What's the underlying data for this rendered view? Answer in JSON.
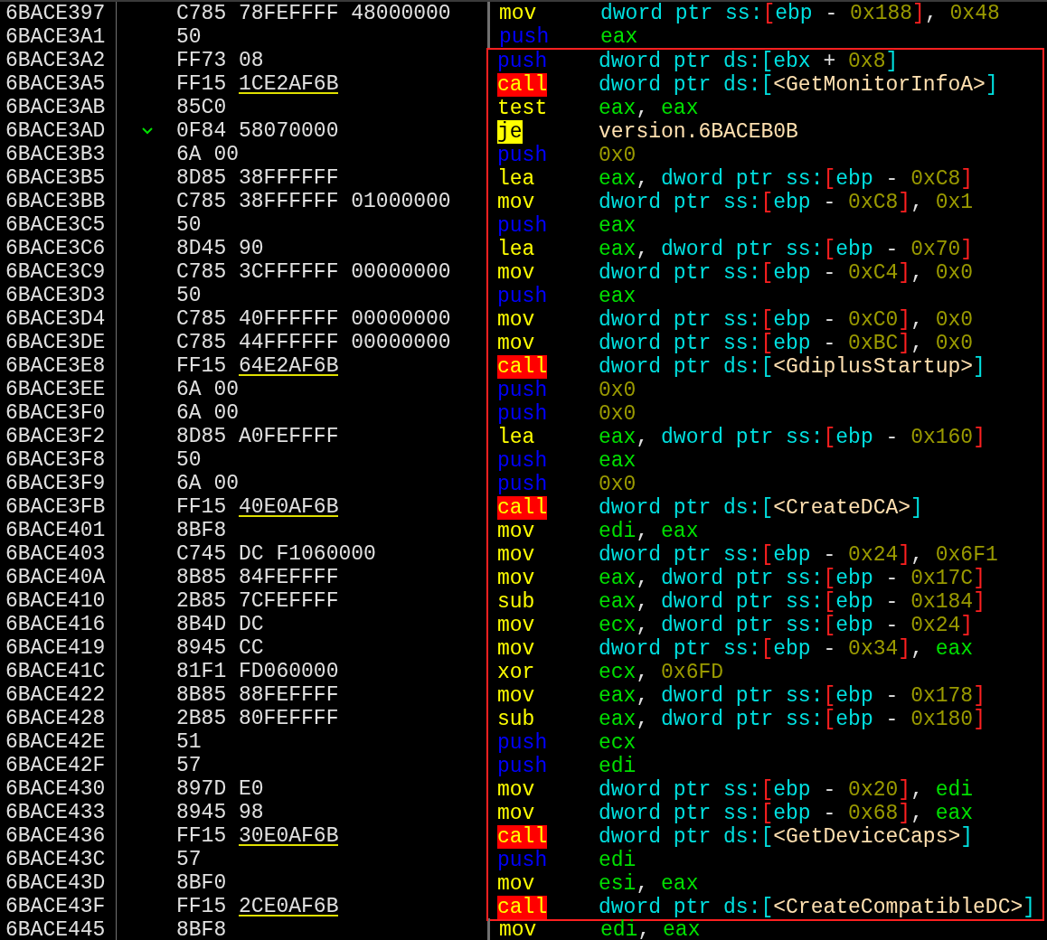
{
  "rows": [
    {
      "address": "6BACE397",
      "branch": false,
      "bytes": "C785 78FEFFFF 48000000",
      "mnemonic": "mov",
      "kind": "plain",
      "boxed": false,
      "operands": [
        {
          "kind": "mem",
          "text": "dword ptr ss:"
        },
        {
          "kind": "bracket",
          "text": "["
        },
        {
          "kind": "mem",
          "text": "ebp"
        },
        {
          "kind": "sep",
          "text": " - "
        },
        {
          "kind": "num",
          "text": "0x188"
        },
        {
          "kind": "bracket",
          "text": "]"
        },
        {
          "kind": "sep",
          "text": ", "
        },
        {
          "kind": "num",
          "text": "0x48"
        }
      ]
    },
    {
      "address": "6BACE3A1",
      "branch": false,
      "bytes": "50",
      "mnemonic": "push",
      "kind": "push",
      "boxed": false,
      "operands": [
        {
          "kind": "reg",
          "text": "eax"
        }
      ]
    },
    {
      "address": "6BACE3A2",
      "branch": false,
      "bytes": "FF73 08",
      "mnemonic": "push",
      "kind": "push",
      "boxed": true,
      "operands": [
        {
          "kind": "mem",
          "text": "dword ptr ds:[ebx"
        },
        {
          "kind": "sep",
          "text": " + "
        },
        {
          "kind": "num",
          "text": "0x8"
        },
        {
          "kind": "mem",
          "text": "]"
        }
      ]
    },
    {
      "address": "6BACE3A5",
      "branch": false,
      "bytes": "FF15",
      "ref": "1CE2AF6B",
      "mnemonic": "call",
      "kind": "call",
      "boxed": true,
      "operands": [
        {
          "kind": "mem",
          "text": "dword ptr ds:["
        },
        {
          "kind": "sym",
          "text": "<GetMonitorInfoA>"
        },
        {
          "kind": "mem",
          "text": "]"
        }
      ]
    },
    {
      "address": "6BACE3AB",
      "branch": false,
      "bytes": "85C0",
      "mnemonic": "test",
      "kind": "plain",
      "boxed": true,
      "operands": [
        {
          "kind": "reg",
          "text": "eax"
        },
        {
          "kind": "sep",
          "text": ", "
        },
        {
          "kind": "reg",
          "text": "eax"
        }
      ]
    },
    {
      "address": "6BACE3AD",
      "branch": true,
      "bytes": "0F84 58070000",
      "mnemonic": "je",
      "kind": "jump",
      "boxed": true,
      "operands": [
        {
          "kind": "sym",
          "text": "version.6BACEB0B"
        }
      ]
    },
    {
      "address": "6BACE3B3",
      "branch": false,
      "bytes": "6A 00",
      "mnemonic": "push",
      "kind": "push",
      "boxed": true,
      "operands": [
        {
          "kind": "num",
          "text": "0x0"
        }
      ]
    },
    {
      "address": "6BACE3B5",
      "branch": false,
      "bytes": "8D85 38FFFFFF",
      "mnemonic": "lea",
      "kind": "plain",
      "boxed": true,
      "operands": [
        {
          "kind": "reg",
          "text": "eax"
        },
        {
          "kind": "sep",
          "text": ", "
        },
        {
          "kind": "mem",
          "text": "dword ptr ss:"
        },
        {
          "kind": "bracket",
          "text": "["
        },
        {
          "kind": "mem",
          "text": "ebp"
        },
        {
          "kind": "sep",
          "text": " - "
        },
        {
          "kind": "num",
          "text": "0xC8"
        },
        {
          "kind": "bracket",
          "text": "]"
        }
      ]
    },
    {
      "address": "6BACE3BB",
      "branch": false,
      "bytes": "C785 38FFFFFF 01000000",
      "mnemonic": "mov",
      "kind": "plain",
      "boxed": true,
      "operands": [
        {
          "kind": "mem",
          "text": "dword ptr ss:"
        },
        {
          "kind": "bracket",
          "text": "["
        },
        {
          "kind": "mem",
          "text": "ebp"
        },
        {
          "kind": "sep",
          "text": " - "
        },
        {
          "kind": "num",
          "text": "0xC8"
        },
        {
          "kind": "bracket",
          "text": "]"
        },
        {
          "kind": "sep",
          "text": ", "
        },
        {
          "kind": "num",
          "text": "0x1"
        }
      ]
    },
    {
      "address": "6BACE3C5",
      "branch": false,
      "bytes": "50",
      "mnemonic": "push",
      "kind": "push",
      "boxed": true,
      "operands": [
        {
          "kind": "reg",
          "text": "eax"
        }
      ]
    },
    {
      "address": "6BACE3C6",
      "branch": false,
      "bytes": "8D45 90",
      "mnemonic": "lea",
      "kind": "plain",
      "boxed": true,
      "operands": [
        {
          "kind": "reg",
          "text": "eax"
        },
        {
          "kind": "sep",
          "text": ", "
        },
        {
          "kind": "mem",
          "text": "dword ptr ss:"
        },
        {
          "kind": "bracket",
          "text": "["
        },
        {
          "kind": "mem",
          "text": "ebp"
        },
        {
          "kind": "sep",
          "text": " - "
        },
        {
          "kind": "num",
          "text": "0x70"
        },
        {
          "kind": "bracket",
          "text": "]"
        }
      ]
    },
    {
      "address": "6BACE3C9",
      "branch": false,
      "bytes": "C785 3CFFFFFF 00000000",
      "mnemonic": "mov",
      "kind": "plain",
      "boxed": true,
      "operands": [
        {
          "kind": "mem",
          "text": "dword ptr ss:"
        },
        {
          "kind": "bracket",
          "text": "["
        },
        {
          "kind": "mem",
          "text": "ebp"
        },
        {
          "kind": "sep",
          "text": " - "
        },
        {
          "kind": "num",
          "text": "0xC4"
        },
        {
          "kind": "bracket",
          "text": "]"
        },
        {
          "kind": "sep",
          "text": ", "
        },
        {
          "kind": "num",
          "text": "0x0"
        }
      ]
    },
    {
      "address": "6BACE3D3",
      "branch": false,
      "bytes": "50",
      "mnemonic": "push",
      "kind": "push",
      "boxed": true,
      "operands": [
        {
          "kind": "reg",
          "text": "eax"
        }
      ]
    },
    {
      "address": "6BACE3D4",
      "branch": false,
      "bytes": "C785 40FFFFFF 00000000",
      "mnemonic": "mov",
      "kind": "plain",
      "boxed": true,
      "operands": [
        {
          "kind": "mem",
          "text": "dword ptr ss:"
        },
        {
          "kind": "bracket",
          "text": "["
        },
        {
          "kind": "mem",
          "text": "ebp"
        },
        {
          "kind": "sep",
          "text": " - "
        },
        {
          "kind": "num",
          "text": "0xC0"
        },
        {
          "kind": "bracket",
          "text": "]"
        },
        {
          "kind": "sep",
          "text": ", "
        },
        {
          "kind": "num",
          "text": "0x0"
        }
      ]
    },
    {
      "address": "6BACE3DE",
      "branch": false,
      "bytes": "C785 44FFFFFF 00000000",
      "mnemonic": "mov",
      "kind": "plain",
      "boxed": true,
      "operands": [
        {
          "kind": "mem",
          "text": "dword ptr ss:"
        },
        {
          "kind": "bracket",
          "text": "["
        },
        {
          "kind": "mem",
          "text": "ebp"
        },
        {
          "kind": "sep",
          "text": " - "
        },
        {
          "kind": "num",
          "text": "0xBC"
        },
        {
          "kind": "bracket",
          "text": "]"
        },
        {
          "kind": "sep",
          "text": ", "
        },
        {
          "kind": "num",
          "text": "0x0"
        }
      ]
    },
    {
      "address": "6BACE3E8",
      "branch": false,
      "bytes": "FF15",
      "ref": "64E2AF6B",
      "mnemonic": "call",
      "kind": "call",
      "boxed": true,
      "operands": [
        {
          "kind": "mem",
          "text": "dword ptr ds:["
        },
        {
          "kind": "sym",
          "text": "<GdiplusStartup>"
        },
        {
          "kind": "mem",
          "text": "]"
        }
      ]
    },
    {
      "address": "6BACE3EE",
      "branch": false,
      "bytes": "6A 00",
      "mnemonic": "push",
      "kind": "push",
      "boxed": true,
      "operands": [
        {
          "kind": "num",
          "text": "0x0"
        }
      ]
    },
    {
      "address": "6BACE3F0",
      "branch": false,
      "bytes": "6A 00",
      "mnemonic": "push",
      "kind": "push",
      "boxed": true,
      "operands": [
        {
          "kind": "num",
          "text": "0x0"
        }
      ]
    },
    {
      "address": "6BACE3F2",
      "branch": false,
      "bytes": "8D85 A0FEFFFF",
      "mnemonic": "lea",
      "kind": "plain",
      "boxed": true,
      "operands": [
        {
          "kind": "reg",
          "text": "eax"
        },
        {
          "kind": "sep",
          "text": ", "
        },
        {
          "kind": "mem",
          "text": "dword ptr ss:"
        },
        {
          "kind": "bracket",
          "text": "["
        },
        {
          "kind": "mem",
          "text": "ebp"
        },
        {
          "kind": "sep",
          "text": " - "
        },
        {
          "kind": "num",
          "text": "0x160"
        },
        {
          "kind": "bracket",
          "text": "]"
        }
      ]
    },
    {
      "address": "6BACE3F8",
      "branch": false,
      "bytes": "50",
      "mnemonic": "push",
      "kind": "push",
      "boxed": true,
      "operands": [
        {
          "kind": "reg",
          "text": "eax"
        }
      ]
    },
    {
      "address": "6BACE3F9",
      "branch": false,
      "bytes": "6A 00",
      "mnemonic": "push",
      "kind": "push",
      "boxed": true,
      "operands": [
        {
          "kind": "num",
          "text": "0x0"
        }
      ]
    },
    {
      "address": "6BACE3FB",
      "branch": false,
      "bytes": "FF15",
      "ref": "40E0AF6B",
      "mnemonic": "call",
      "kind": "call",
      "boxed": true,
      "operands": [
        {
          "kind": "mem",
          "text": "dword ptr ds:["
        },
        {
          "kind": "sym",
          "text": "<CreateDCA>"
        },
        {
          "kind": "mem",
          "text": "]"
        }
      ]
    },
    {
      "address": "6BACE401",
      "branch": false,
      "bytes": "8BF8",
      "mnemonic": "mov",
      "kind": "plain",
      "boxed": true,
      "operands": [
        {
          "kind": "reg",
          "text": "edi"
        },
        {
          "kind": "sep",
          "text": ", "
        },
        {
          "kind": "reg",
          "text": "eax"
        }
      ]
    },
    {
      "address": "6BACE403",
      "branch": false,
      "bytes": "C745 DC F1060000",
      "mnemonic": "mov",
      "kind": "plain",
      "boxed": true,
      "operands": [
        {
          "kind": "mem",
          "text": "dword ptr ss:"
        },
        {
          "kind": "bracket",
          "text": "["
        },
        {
          "kind": "mem",
          "text": "ebp"
        },
        {
          "kind": "sep",
          "text": " - "
        },
        {
          "kind": "num",
          "text": "0x24"
        },
        {
          "kind": "bracket",
          "text": "]"
        },
        {
          "kind": "sep",
          "text": ", "
        },
        {
          "kind": "num",
          "text": "0x6F1"
        }
      ]
    },
    {
      "address": "6BACE40A",
      "branch": false,
      "bytes": "8B85 84FEFFFF",
      "mnemonic": "mov",
      "kind": "plain",
      "boxed": true,
      "operands": [
        {
          "kind": "reg",
          "text": "eax"
        },
        {
          "kind": "sep",
          "text": ", "
        },
        {
          "kind": "mem",
          "text": "dword ptr ss:"
        },
        {
          "kind": "bracket",
          "text": "["
        },
        {
          "kind": "mem",
          "text": "ebp"
        },
        {
          "kind": "sep",
          "text": " - "
        },
        {
          "kind": "num",
          "text": "0x17C"
        },
        {
          "kind": "bracket",
          "text": "]"
        }
      ]
    },
    {
      "address": "6BACE410",
      "branch": false,
      "bytes": "2B85 7CFEFFFF",
      "mnemonic": "sub",
      "kind": "plain",
      "boxed": true,
      "operands": [
        {
          "kind": "reg",
          "text": "eax"
        },
        {
          "kind": "sep",
          "text": ", "
        },
        {
          "kind": "mem",
          "text": "dword ptr ss:"
        },
        {
          "kind": "bracket",
          "text": "["
        },
        {
          "kind": "mem",
          "text": "ebp"
        },
        {
          "kind": "sep",
          "text": " - "
        },
        {
          "kind": "num",
          "text": "0x184"
        },
        {
          "kind": "bracket",
          "text": "]"
        }
      ]
    },
    {
      "address": "6BACE416",
      "branch": false,
      "bytes": "8B4D DC",
      "mnemonic": "mov",
      "kind": "plain",
      "boxed": true,
      "operands": [
        {
          "kind": "reg",
          "text": "ecx"
        },
        {
          "kind": "sep",
          "text": ", "
        },
        {
          "kind": "mem",
          "text": "dword ptr ss:"
        },
        {
          "kind": "bracket",
          "text": "["
        },
        {
          "kind": "mem",
          "text": "ebp"
        },
        {
          "kind": "sep",
          "text": " - "
        },
        {
          "kind": "num",
          "text": "0x24"
        },
        {
          "kind": "bracket",
          "text": "]"
        }
      ]
    },
    {
      "address": "6BACE419",
      "branch": false,
      "bytes": "8945 CC",
      "mnemonic": "mov",
      "kind": "plain",
      "boxed": true,
      "operands": [
        {
          "kind": "mem",
          "text": "dword ptr ss:"
        },
        {
          "kind": "bracket",
          "text": "["
        },
        {
          "kind": "mem",
          "text": "ebp"
        },
        {
          "kind": "sep",
          "text": " - "
        },
        {
          "kind": "num",
          "text": "0x34"
        },
        {
          "kind": "bracket",
          "text": "]"
        },
        {
          "kind": "sep",
          "text": ", "
        },
        {
          "kind": "reg",
          "text": "eax"
        }
      ]
    },
    {
      "address": "6BACE41C",
      "branch": false,
      "bytes": "81F1 FD060000",
      "mnemonic": "xor",
      "kind": "plain",
      "boxed": true,
      "operands": [
        {
          "kind": "reg",
          "text": "ecx"
        },
        {
          "kind": "sep",
          "text": ", "
        },
        {
          "kind": "num",
          "text": "0x6FD"
        }
      ]
    },
    {
      "address": "6BACE422",
      "branch": false,
      "bytes": "8B85 88FEFFFF",
      "mnemonic": "mov",
      "kind": "plain",
      "boxed": true,
      "operands": [
        {
          "kind": "reg",
          "text": "eax"
        },
        {
          "kind": "sep",
          "text": ", "
        },
        {
          "kind": "mem",
          "text": "dword ptr ss:"
        },
        {
          "kind": "bracket",
          "text": "["
        },
        {
          "kind": "mem",
          "text": "ebp"
        },
        {
          "kind": "sep",
          "text": " - "
        },
        {
          "kind": "num",
          "text": "0x178"
        },
        {
          "kind": "bracket",
          "text": "]"
        }
      ]
    },
    {
      "address": "6BACE428",
      "branch": false,
      "bytes": "2B85 80FEFFFF",
      "mnemonic": "sub",
      "kind": "plain",
      "boxed": true,
      "operands": [
        {
          "kind": "reg",
          "text": "eax"
        },
        {
          "kind": "sep",
          "text": ", "
        },
        {
          "kind": "mem",
          "text": "dword ptr ss:"
        },
        {
          "kind": "bracket",
          "text": "["
        },
        {
          "kind": "mem",
          "text": "ebp"
        },
        {
          "kind": "sep",
          "text": " - "
        },
        {
          "kind": "num",
          "text": "0x180"
        },
        {
          "kind": "bracket",
          "text": "]"
        }
      ]
    },
    {
      "address": "6BACE42E",
      "branch": false,
      "bytes": "51",
      "mnemonic": "push",
      "kind": "push",
      "boxed": true,
      "operands": [
        {
          "kind": "reg",
          "text": "ecx"
        }
      ]
    },
    {
      "address": "6BACE42F",
      "branch": false,
      "bytes": "57",
      "mnemonic": "push",
      "kind": "push",
      "boxed": true,
      "operands": [
        {
          "kind": "reg",
          "text": "edi"
        }
      ]
    },
    {
      "address": "6BACE430",
      "branch": false,
      "bytes": "897D E0",
      "mnemonic": "mov",
      "kind": "plain",
      "boxed": true,
      "operands": [
        {
          "kind": "mem",
          "text": "dword ptr ss:"
        },
        {
          "kind": "bracket",
          "text": "["
        },
        {
          "kind": "mem",
          "text": "ebp"
        },
        {
          "kind": "sep",
          "text": " - "
        },
        {
          "kind": "num",
          "text": "0x20"
        },
        {
          "kind": "bracket",
          "text": "]"
        },
        {
          "kind": "sep",
          "text": ", "
        },
        {
          "kind": "reg",
          "text": "edi"
        }
      ]
    },
    {
      "address": "6BACE433",
      "branch": false,
      "bytes": "8945 98",
      "mnemonic": "mov",
      "kind": "plain",
      "boxed": true,
      "operands": [
        {
          "kind": "mem",
          "text": "dword ptr ss:"
        },
        {
          "kind": "bracket",
          "text": "["
        },
        {
          "kind": "mem",
          "text": "ebp"
        },
        {
          "kind": "sep",
          "text": " - "
        },
        {
          "kind": "num",
          "text": "0x68"
        },
        {
          "kind": "bracket",
          "text": "]"
        },
        {
          "kind": "sep",
          "text": ", "
        },
        {
          "kind": "reg",
          "text": "eax"
        }
      ]
    },
    {
      "address": "6BACE436",
      "branch": false,
      "bytes": "FF15",
      "ref": "30E0AF6B",
      "mnemonic": "call",
      "kind": "call",
      "boxed": true,
      "operands": [
        {
          "kind": "mem",
          "text": "dword ptr ds:["
        },
        {
          "kind": "sym",
          "text": "<GetDeviceCaps>"
        },
        {
          "kind": "mem",
          "text": "]"
        }
      ]
    },
    {
      "address": "6BACE43C",
      "branch": false,
      "bytes": "57",
      "mnemonic": "push",
      "kind": "push",
      "boxed": true,
      "operands": [
        {
          "kind": "reg",
          "text": "edi"
        }
      ]
    },
    {
      "address": "6BACE43D",
      "branch": false,
      "bytes": "8BF0",
      "mnemonic": "mov",
      "kind": "plain",
      "boxed": true,
      "operands": [
        {
          "kind": "reg",
          "text": "esi"
        },
        {
          "kind": "sep",
          "text": ", "
        },
        {
          "kind": "reg",
          "text": "eax"
        }
      ]
    },
    {
      "address": "6BACE43F",
      "branch": false,
      "bytes": "FF15",
      "ref": "2CE0AF6B",
      "mnemonic": "call",
      "kind": "call",
      "boxed": true,
      "operands": [
        {
          "kind": "mem",
          "text": "dword ptr ds:["
        },
        {
          "kind": "sym",
          "text": "<CreateCompatibleDC>"
        },
        {
          "kind": "mem",
          "text": "]"
        }
      ]
    },
    {
      "address": "6BACE445",
      "branch": false,
      "bytes": "8BF8",
      "mnemonic": "mov",
      "kind": "plain",
      "boxed": false,
      "operands": [
        {
          "kind": "reg",
          "text": "edi"
        },
        {
          "kind": "sep",
          "text": ", "
        },
        {
          "kind": "reg",
          "text": "eax"
        }
      ]
    }
  ]
}
